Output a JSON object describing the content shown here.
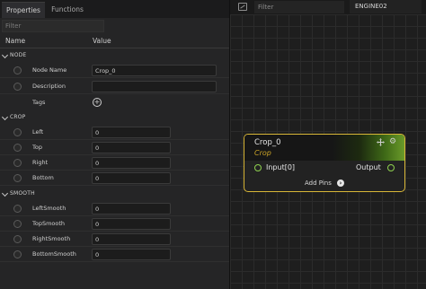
{
  "tabs": [
    {
      "label": "Properties",
      "active": true
    },
    {
      "label": "Functions",
      "active": false
    }
  ],
  "filter": {
    "placeholder": "Filter",
    "value": ""
  },
  "columns": {
    "name": "Name",
    "value": "Value"
  },
  "sections": {
    "node": {
      "label": "NODE",
      "rows": {
        "node_name": {
          "label": "Node Name",
          "value": "Crop_0"
        },
        "description": {
          "label": "Description",
          "value": ""
        },
        "tags": {
          "label": "Tags",
          "add_icon": "plus-circle-icon"
        }
      }
    },
    "crop": {
      "label": "CROP",
      "rows": [
        {
          "label": "Left",
          "value": "0"
        },
        {
          "label": "Top",
          "value": "0"
        },
        {
          "label": "Right",
          "value": "0"
        },
        {
          "label": "Bottom",
          "value": "0"
        }
      ]
    },
    "smooth": {
      "label": "SMOOTH",
      "rows": [
        {
          "label": "LeftSmooth",
          "value": "0"
        },
        {
          "label": "TopSmooth",
          "value": "0"
        },
        {
          "label": "RightSmooth",
          "value": "0"
        },
        {
          "label": "BottomSmooth",
          "value": "0"
        }
      ]
    }
  },
  "graph": {
    "filter_placeholder": "Filter",
    "engine_label": "ENGINE02",
    "node": {
      "title": "Crop_0",
      "subtitle": "Crop",
      "input_label": "Input[0]",
      "output_label": "Output",
      "add_pins_label": "Add Pins",
      "border_color": "#d8b637",
      "pin_color": "#8fd14f",
      "header_accent": "#6a9a2a"
    }
  }
}
